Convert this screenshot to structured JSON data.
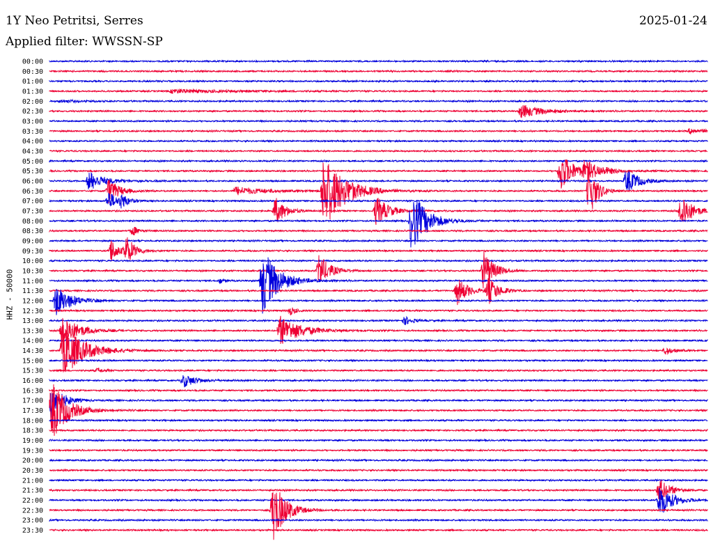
{
  "header": {
    "title": "1Y Neo Petritsi, Serres",
    "date": "2025-01-24",
    "filter": "Applied filter: WWSSN-SP"
  },
  "chart_data": {
    "type": "line",
    "title": "1Y Neo Petritsi, Serres",
    "ylabel": "HHZ - 50000",
    "colors": {
      "even": "#0000dd",
      "odd": "#ee0033"
    },
    "trace_labels": [
      "00:00",
      "00:30",
      "01:00",
      "01:30",
      "02:00",
      "02:30",
      "03:00",
      "03:30",
      "04:00",
      "04:30",
      "05:00",
      "05:30",
      "06:00",
      "06:30",
      "07:00",
      "07:30",
      "08:00",
      "08:30",
      "09:00",
      "09:30",
      "10:00",
      "10:30",
      "11:00",
      "11:30",
      "12:00",
      "12:30",
      "13:00",
      "13:30",
      "14:00",
      "14:30",
      "15:00",
      "15:30",
      "16:00",
      "16:30",
      "17:00",
      "17:30",
      "18:00",
      "18:30",
      "19:00",
      "19:30",
      "20:00",
      "20:30",
      "21:00",
      "21:30",
      "22:00",
      "22:30",
      "23:00",
      "23:30"
    ],
    "events": [
      {
        "trace": "01:30",
        "minute": 5.6,
        "amp": 3,
        "dur": 5
      },
      {
        "trace": "02:00",
        "minute": 0.5,
        "amp": 2,
        "dur": 2
      },
      {
        "trace": "02:30",
        "minute": 21.5,
        "amp": 10,
        "dur": 2
      },
      {
        "trace": "03:30",
        "minute": 29.2,
        "amp": 4,
        "dur": 1.5
      },
      {
        "trace": "05:30",
        "minute": 23.3,
        "amp": 30,
        "dur": 1.2
      },
      {
        "trace": "05:30",
        "minute": 24.4,
        "amp": 12,
        "dur": 2
      },
      {
        "trace": "06:00",
        "minute": 1.8,
        "amp": 14,
        "dur": 1.5
      },
      {
        "trace": "06:00",
        "minute": 26.3,
        "amp": 18,
        "dur": 1.2
      },
      {
        "trace": "06:30",
        "minute": 2.7,
        "amp": 18,
        "dur": 1
      },
      {
        "trace": "06:30",
        "minute": 12.5,
        "amp": 55,
        "dur": 2
      },
      {
        "trace": "06:30",
        "minute": 8.5,
        "amp": 6,
        "dur": 3
      },
      {
        "trace": "06:30",
        "minute": 24.6,
        "amp": 40,
        "dur": 0.8
      },
      {
        "trace": "07:00",
        "minute": 2.7,
        "amp": 14,
        "dur": 0.8
      },
      {
        "trace": "07:00",
        "minute": 3.3,
        "amp": 10,
        "dur": 0.6
      },
      {
        "trace": "07:30",
        "minute": 10.3,
        "amp": 20,
        "dur": 1
      },
      {
        "trace": "07:30",
        "minute": 14.9,
        "amp": 22,
        "dur": 1.2
      },
      {
        "trace": "07:30",
        "minute": 28.8,
        "amp": 28,
        "dur": 1
      },
      {
        "trace": "08:00",
        "minute": 16.5,
        "amp": 45,
        "dur": 1.5
      },
      {
        "trace": "08:30",
        "minute": 3.8,
        "amp": 7,
        "dur": 0.6
      },
      {
        "trace": "09:30",
        "minute": 2.8,
        "amp": 18,
        "dur": 0.7
      },
      {
        "trace": "09:30",
        "minute": 3.5,
        "amp": 22,
        "dur": 0.8
      },
      {
        "trace": "10:30",
        "minute": 12.3,
        "amp": 25,
        "dur": 1
      },
      {
        "trace": "10:30",
        "minute": 19.8,
        "amp": 30,
        "dur": 1
      },
      {
        "trace": "11:00",
        "minute": 9.7,
        "amp": 50,
        "dur": 1.5
      },
      {
        "trace": "11:00",
        "minute": 7.8,
        "amp": 4,
        "dur": 0.3
      },
      {
        "trace": "11:30",
        "minute": 18.6,
        "amp": 20,
        "dur": 1
      },
      {
        "trace": "11:30",
        "minute": 20.0,
        "amp": 20,
        "dur": 1
      },
      {
        "trace": "12:00",
        "minute": 0.3,
        "amp": 22,
        "dur": 1.5
      },
      {
        "trace": "12:30",
        "minute": 11.0,
        "amp": 6,
        "dur": 0.5
      },
      {
        "trace": "13:00",
        "minute": 16.2,
        "amp": 6,
        "dur": 0.8
      },
      {
        "trace": "13:30",
        "minute": 10.5,
        "amp": 22,
        "dur": 2
      },
      {
        "trace": "13:30",
        "minute": 0.6,
        "amp": 24,
        "dur": 1.5
      },
      {
        "trace": "14:00",
        "minute": 31.2,
        "amp": 25,
        "dur": 1
      },
      {
        "trace": "14:30",
        "minute": 0.6,
        "amp": 40,
        "dur": 2
      },
      {
        "trace": "14:30",
        "minute": 28.1,
        "amp": 6,
        "dur": 0.8
      },
      {
        "trace": "15:30",
        "minute": 2.2,
        "amp": 4,
        "dur": 0.5
      },
      {
        "trace": "16:00",
        "minute": 6.1,
        "amp": 10,
        "dur": 1.2
      },
      {
        "trace": "17:00",
        "minute": 30.7,
        "amp": 12,
        "dur": 1
      },
      {
        "trace": "17:00",
        "minute": 0.1,
        "amp": 30,
        "dur": 1
      },
      {
        "trace": "17:30",
        "minute": 0.1,
        "amp": 45,
        "dur": 1.5
      },
      {
        "trace": "21:30",
        "minute": 27.8,
        "amp": 18,
        "dur": 1
      },
      {
        "trace": "22:00",
        "minute": 27.8,
        "amp": 25,
        "dur": 1.2
      },
      {
        "trace": "22:30",
        "minute": 10.2,
        "amp": 45,
        "dur": 1.2
      }
    ]
  }
}
